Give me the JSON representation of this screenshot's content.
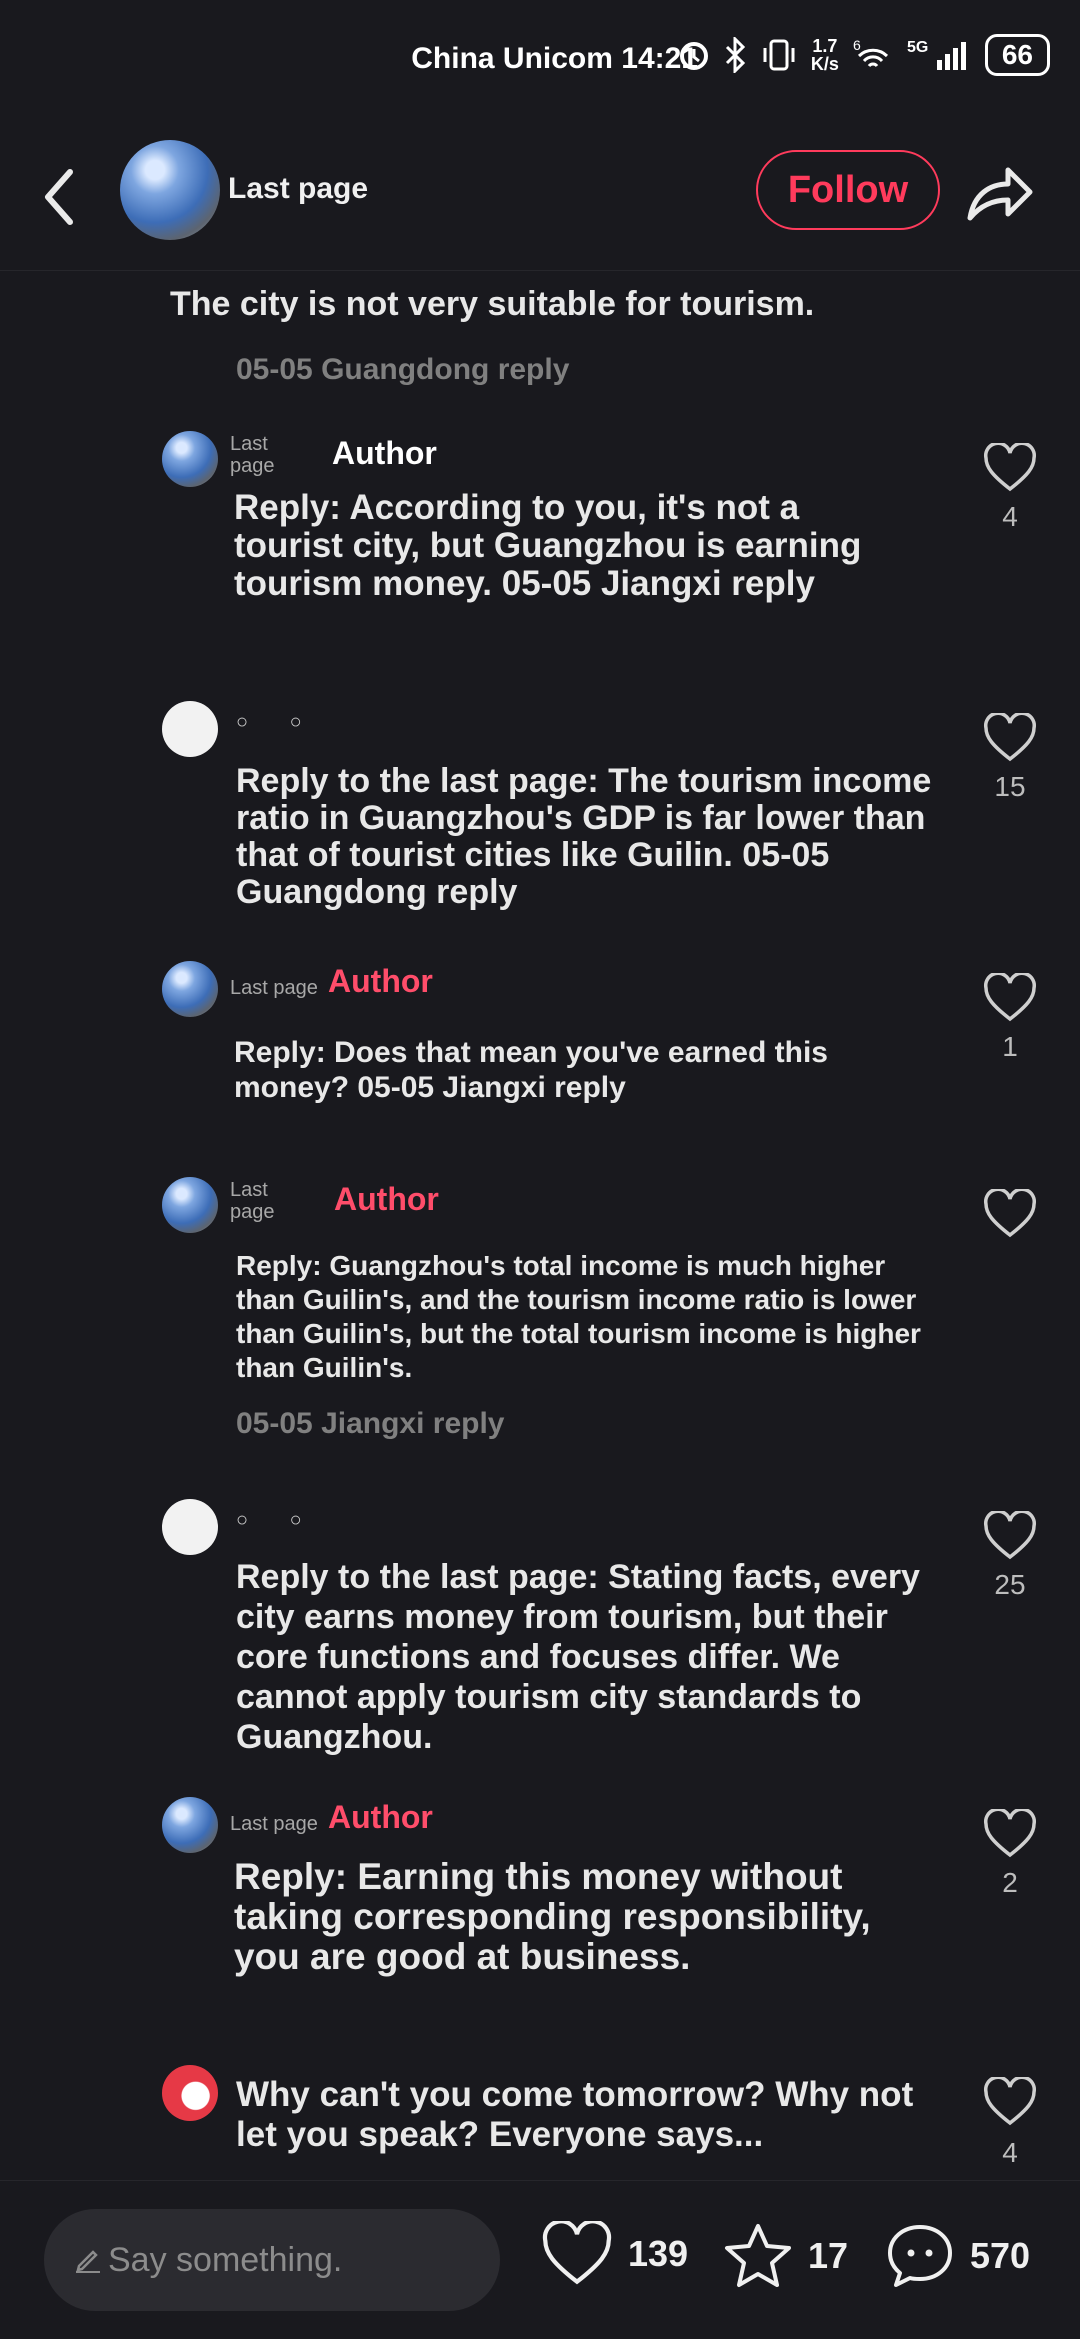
{
  "status_bar": {
    "carrier_time": "China Unicom 14:21",
    "speed_top": "1.7",
    "speed_unit": "K/s",
    "wifi_label": "6",
    "network": "5G",
    "battery": "66"
  },
  "header": {
    "title": "Last page",
    "follow_label": "Follow"
  },
  "comments": [
    {
      "text": "The city is not very suitable for tourism.",
      "meta": "05-05 Guangdong reply"
    },
    {
      "name": "Last page",
      "badge": "Author",
      "text": "Reply: According to you, it's not a tourist city, but Guangzhou is earning tourism money. 05-05 Jiangxi reply",
      "likes": "4"
    },
    {
      "dots": "○ ○",
      "text": "Reply to the last page: The tourism income ratio in Guangzhou's GDP is far lower than that of tourist cities like Guilin. 05-05 Guangdong reply",
      "likes": "15"
    },
    {
      "name": "Last page",
      "badge": "Author",
      "text": "Reply: Does that mean you've earned this money? 05-05 Jiangxi reply",
      "likes": "1"
    },
    {
      "name": "Last page",
      "badge": "Author",
      "text": "Reply: Guangzhou's total income is much higher than Guilin's, and the tourism income ratio is lower than Guilin's, but the total tourism income is higher than Guilin's.",
      "meta": "05-05 Jiangxi reply"
    },
    {
      "dots": "○ ○",
      "text": "Reply to the last page: Stating facts, every city earns money from tourism, but their core functions and focuses differ. We cannot apply tourism city standards to Guangzhou.",
      "likes": "25"
    },
    {
      "name": "Last page",
      "badge": "Author",
      "text": "Reply: Earning this money without taking corresponding responsibility, you are good at business.",
      "likes": "2"
    },
    {
      "text": "Why can't you come tomorrow? Why not let you speak? Everyone says...",
      "likes": "4"
    }
  ],
  "bottom_bar": {
    "input_placeholder": "Say something.",
    "likes": "139",
    "favorites": "17",
    "comments": "570"
  },
  "colors": {
    "background": "#19191e",
    "accent": "#ff3b5c"
  },
  "icons": [
    "back-arrow-icon",
    "share-icon",
    "heart-icon",
    "star-icon",
    "comment-bubble-icon",
    "pen-icon",
    "bluetooth-icon",
    "wifi-icon",
    "signal-icon",
    "battery-icon"
  ]
}
